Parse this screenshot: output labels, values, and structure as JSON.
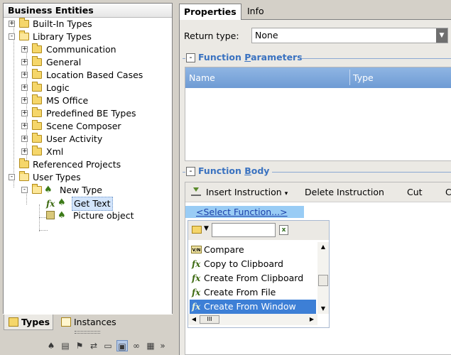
{
  "left_pane": {
    "title": "Business Entities",
    "tree": [
      {
        "label": "Built-In Types",
        "expander": "+"
      },
      {
        "label": "Library Types",
        "expander": "-"
      },
      {
        "label": "Communication",
        "expander": "+"
      },
      {
        "label": "General",
        "expander": "+"
      },
      {
        "label": "Location Based Cases",
        "expander": "+"
      },
      {
        "label": "Logic",
        "expander": "+"
      },
      {
        "label": "MS Office",
        "expander": "+"
      },
      {
        "label": "Predefined BE Types",
        "expander": "+"
      },
      {
        "label": "Scene Composer",
        "expander": "+"
      },
      {
        "label": "User Activity",
        "expander": "+"
      },
      {
        "label": "Xml",
        "expander": "+"
      },
      {
        "label": "Referenced Projects",
        "expander": ""
      },
      {
        "label": "User Types",
        "expander": "-"
      },
      {
        "label": "New Type",
        "expander": "-"
      },
      {
        "label": "Get Text",
        "expander": ""
      },
      {
        "label": "Picture object",
        "expander": ""
      }
    ],
    "tabs": [
      "Types",
      "Instances"
    ],
    "bottom_toolbar_icons": [
      "type-icon",
      "page-icon",
      "flag-icon",
      "link-icon",
      "monitor-icon",
      "object-icon",
      "variable-icon",
      "group-icon",
      "more-icon"
    ]
  },
  "right_pane": {
    "tabs": [
      "Properties",
      "Info"
    ],
    "return_type": {
      "label": "Return type:",
      "value": "None"
    },
    "function_parameters": {
      "title_prefix": "Function ",
      "title_underlined": "P",
      "title_suffix": "arameters",
      "collapse": "-",
      "columns": [
        "Name",
        "Type"
      ]
    },
    "function_body": {
      "title_prefix": "Function ",
      "title_underlined": "B",
      "title_suffix": "ody",
      "collapse": "-",
      "toolbar": {
        "insert": "Insert Instruction",
        "insert_arrow": "▾",
        "delete": "Delete Instruction",
        "cut": "Cut",
        "copy_partial": "C"
      },
      "select_function": "<Select Function...>",
      "picker": {
        "search_value": "",
        "clear_glyph": "x",
        "items": [
          {
            "label": "Compare",
            "icon": "var-icon",
            "icon_text": "V/N"
          },
          {
            "label": "Copy to Clipboard",
            "icon": "function-icon",
            "icon_text": "fx"
          },
          {
            "label": "Create From Clipboard",
            "icon": "function-icon",
            "icon_text": "fx"
          },
          {
            "label": "Create From File",
            "icon": "function-icon",
            "icon_text": "fx"
          },
          {
            "label": "Create From Window",
            "icon": "function-icon",
            "icon_text": "fx"
          }
        ],
        "selected_index": 4,
        "hthumb_glyph": "III"
      }
    }
  },
  "colors": {
    "section_title": "#3a72c0",
    "grid_header": "#7aa4da",
    "selected_item": "#3d7fd6",
    "select_function_bg": "#99ccf5"
  }
}
